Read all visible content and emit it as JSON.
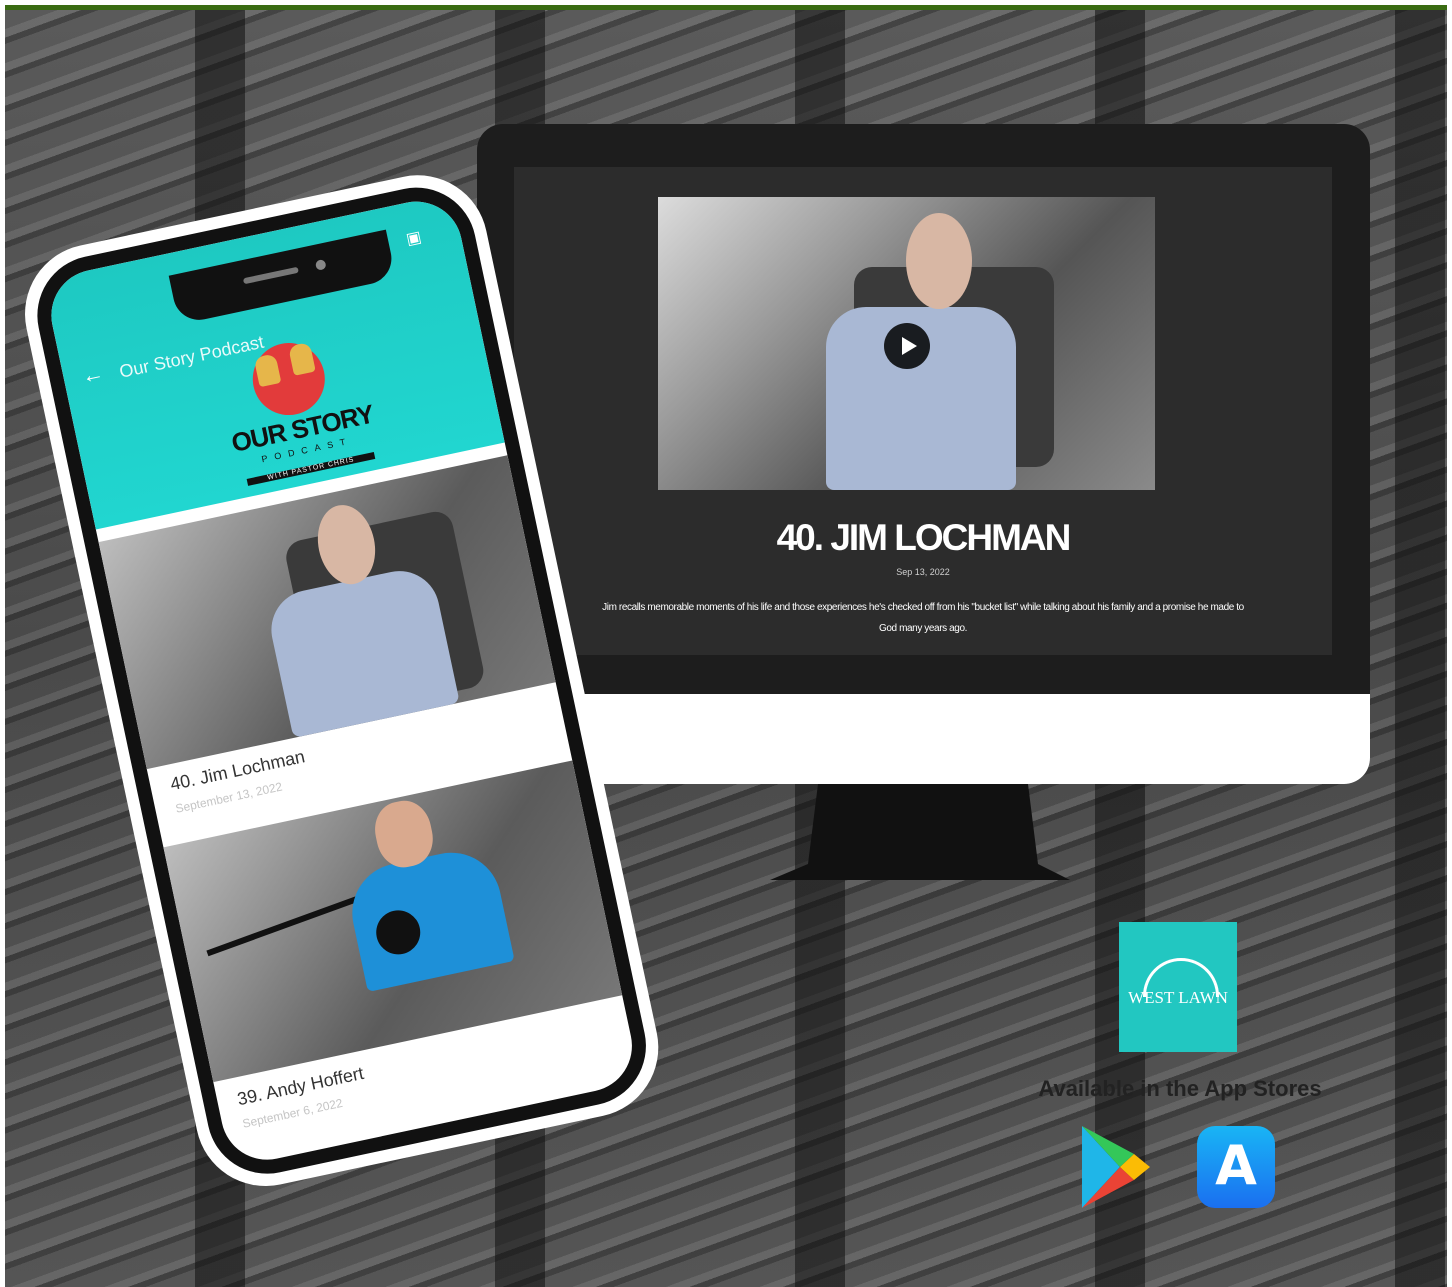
{
  "monitor": {
    "episode_title": "40. JIM LOCHMAN",
    "episode_date": "Sep 13, 2022",
    "episode_description": "Jim recalls memorable moments of his life and those experiences he's checked off from his \"bucket list\" while talking about his family and a promise he made to God many years ago."
  },
  "phone": {
    "app_title": "Our Story Podcast",
    "logo": {
      "main": "OUR STORY",
      "sub": "PODCAST",
      "badge": "WITH PASTOR CHRIS"
    },
    "episodes": [
      {
        "label": "40. Jim Lochman",
        "date": "September 13, 2022"
      },
      {
        "label": "39. Andy Hoffert",
        "date": "September 6, 2022"
      }
    ]
  },
  "promo": {
    "church_logo_text": "WEST LAWN",
    "available_text": "Available in the App Stores",
    "store_icons": [
      "google-play-icon",
      "app-store-icon"
    ]
  },
  "colors": {
    "teal": "#21d6d0",
    "top_border": "#3a6b12",
    "background": "#4f4f4f"
  }
}
